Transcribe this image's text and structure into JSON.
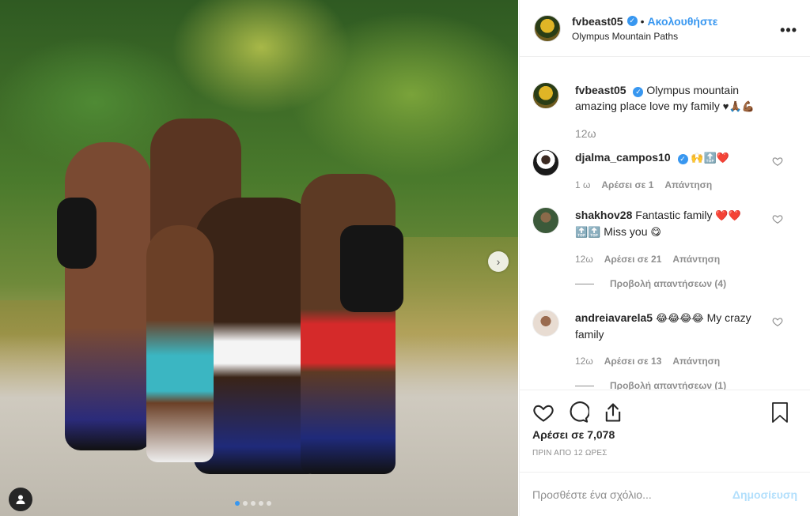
{
  "header": {
    "username": "fvbeast05",
    "verified_icon": "verified-badge-icon",
    "separator": "•",
    "follow_label": "Ακολουθήστε",
    "location": "Olympus Mountain Paths",
    "more_icon": "more-options-icon"
  },
  "caption": {
    "username": "fvbeast05",
    "text": "Olympus mountain amazing place love my family",
    "emojis": "♥🙏🏾💪🏾",
    "time": "12ω"
  },
  "comments": [
    {
      "username": "djalma_campos10",
      "verified": true,
      "text": "",
      "emojis": "🙌🔝❤️",
      "time": "1 ω",
      "likes": "Αρέσει σε 1",
      "reply": "Απάντηση"
    },
    {
      "username": "shakhov28",
      "verified": false,
      "text": "Fantastic family",
      "emojis": "❤️❤️",
      "text2": "Miss you",
      "emojis2_pre": "🔝🔝",
      "emojis2_post": "😋",
      "time": "12ω",
      "likes": "Αρέσει σε 21",
      "reply": "Απάντηση",
      "view_replies": "Προβολή απαντήσεων (4)"
    },
    {
      "username": "andreiavarela5",
      "verified": false,
      "emojis": "😂😂😂😂",
      "text": "My crazy family",
      "time": "12ω",
      "likes": "Αρέσει σε 13",
      "reply": "Απάντηση",
      "view_replies": "Προβολή απαντήσεων (1)"
    }
  ],
  "actions": {
    "likes": "Αρέσει σε 7,078",
    "time": "ΠΡΙΝ ΑΠΟ 12 ΩΡΕΣ"
  },
  "add_comment": {
    "placeholder": "Προσθέστε ένα σχόλιο...",
    "post_label": "Δημοσίευση"
  },
  "carousel": {
    "current_index": 1,
    "total": 5
  },
  "colors": {
    "accent": "#3897f0",
    "muted": "#8e8e8e",
    "post_disabled": "#b2dffc"
  }
}
